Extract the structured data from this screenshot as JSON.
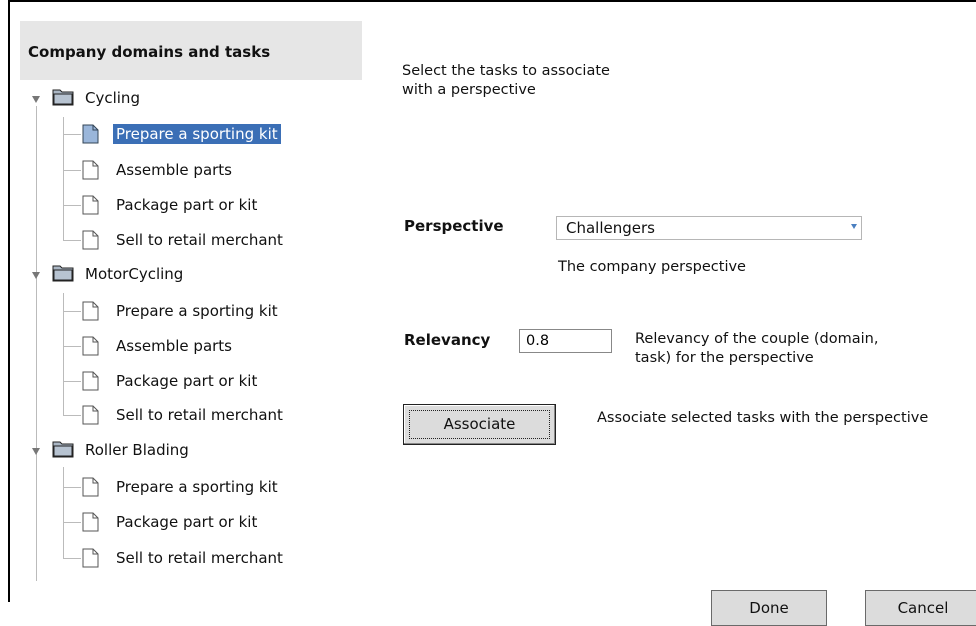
{
  "tree": {
    "header": "Company domains and tasks",
    "domains": [
      {
        "label": "Cycling",
        "tasks": [
          "Prepare a sporting kit",
          "Assemble parts",
          "Package part or kit",
          "Sell to retail merchant"
        ]
      },
      {
        "label": "MotorCycling",
        "tasks": [
          "Prepare a sporting kit",
          "Assemble parts",
          "Package part or kit",
          "Sell to retail merchant"
        ]
      },
      {
        "label": "Roller Blading",
        "tasks": [
          "Prepare a sporting kit",
          "Package part or kit",
          "Sell to retail merchant"
        ]
      }
    ],
    "selected": "Cycling / Prepare a sporting kit"
  },
  "intro": {
    "line1": "Select the tasks to associate",
    "line2": "with a perspective"
  },
  "perspective": {
    "label": "Perspective",
    "value": "Challengers",
    "description": "The company perspective"
  },
  "relevancy": {
    "label": "Relevancy",
    "value": "0.8",
    "description_line1": "Relevancy of the couple (domain,",
    "description_line2": "task) for the perspective"
  },
  "associate": {
    "button": "Associate",
    "description": "Associate selected tasks with the perspective"
  },
  "footer": {
    "done": "Done",
    "cancel": "Cancel"
  },
  "colors": {
    "selection": "#3b6fb6",
    "header_bg": "#e6e6e6",
    "button_bg": "#dcdcdc"
  }
}
